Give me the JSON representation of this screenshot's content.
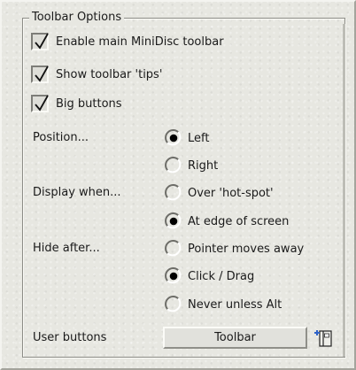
{
  "group": {
    "title": "Toolbar Options"
  },
  "checkboxes": [
    {
      "label": "Enable main MiniDisc toolbar",
      "checked": true
    },
    {
      "label": "Show toolbar 'tips'",
      "checked": true
    },
    {
      "label": "Big buttons",
      "checked": true
    }
  ],
  "position": {
    "label": "Position...",
    "options": [
      {
        "label": "Left",
        "selected": true
      },
      {
        "label": "Right",
        "selected": false
      }
    ]
  },
  "display_when": {
    "label": "Display when...",
    "options": [
      {
        "label": "Over 'hot-spot'",
        "selected": false
      },
      {
        "label": "At edge of screen",
        "selected": true
      }
    ]
  },
  "hide_after": {
    "label": "Hide after...",
    "options": [
      {
        "label": "Pointer moves away",
        "selected": false
      },
      {
        "label": "Click / Drag",
        "selected": true
      },
      {
        "label": "Never unless Alt",
        "selected": false
      }
    ]
  },
  "user_buttons": {
    "label": "User buttons",
    "button_label": "Toolbar",
    "add_icon": "add-toolbar-button-icon"
  },
  "colors": {
    "background": "#e7e7e1",
    "text": "#1a1a1a",
    "radio_dot": "#000000",
    "accent_blue": "#2f63c8"
  }
}
